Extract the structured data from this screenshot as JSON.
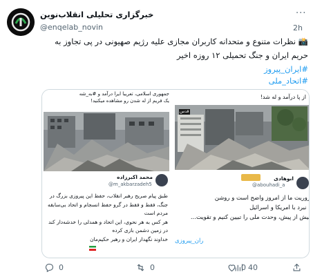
{
  "account": {
    "name": "خبرگزاری تحلیلی انقلاب‌نوین",
    "handle": "@enqelab_novin",
    "time": "2h"
  },
  "tweet": {
    "text": "📸 نظرات متنوع و متحدانه کاربران مجازی علیه رژیم صهیونی در پی تجاوز به حریم ایران و جنگ تحمیلی ۱۲ روزه اخیر",
    "tags": [
      "#ایران_پیروز",
      "#اتحاد_ملی"
    ]
  },
  "left_card": {
    "caption_top": "جمهوری اسلامی، تعریبا ایرا درآمد و #به_شه",
    "caption_line2": "یک فریم از له شدن رو مشاهده میکنید!",
    "quote_name": "محمد اکبرزاده",
    "quote_handle": "@m_akbarzadeh5",
    "quote_lines": [
      "طبق پیام صریح رهبر انقلاب، حفظ این پیروزی بزرگ در",
      "جنگ، فقط و فقط در گرو حفظ انسجام و اتحاد بی‌سابقه",
      "مردم است",
      "هر کس به هر نحوی، این اتحاد و همدلی را خدشه‌دار کند",
      "در زمین دشمن بازی کرده",
      "خداوند نگهدار ایران و رهبر حکیم‌مان"
    ]
  },
  "right_card": {
    "caption_top": "از پا درآمد و له شد!",
    "badge": "قدس",
    "quote_name": "ابوهادی",
    "quote_handle": "@abouhadi_a",
    "quote_lines": [
      "روریت ما از امروز واضح است و روشن",
      "، نبرد با امریکا و اسرائیل",
      "بیش از پیش، وحدت ملی را تبیین کنیم و تقویت..."
    ],
    "tag": "ران_پیروزی"
  },
  "actions": {
    "reply": "0",
    "retweet": "0",
    "like": "0",
    "views": "40"
  }
}
